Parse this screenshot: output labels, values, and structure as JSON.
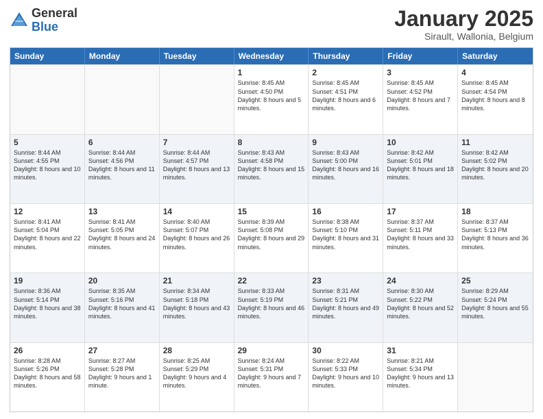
{
  "logo": {
    "general": "General",
    "blue": "Blue"
  },
  "header": {
    "title": "January 2025",
    "location": "Sirault, Wallonia, Belgium"
  },
  "weekdays": [
    "Sunday",
    "Monday",
    "Tuesday",
    "Wednesday",
    "Thursday",
    "Friday",
    "Saturday"
  ],
  "weeks": [
    [
      {
        "day": "",
        "sunrise": "",
        "sunset": "",
        "daylight": ""
      },
      {
        "day": "",
        "sunrise": "",
        "sunset": "",
        "daylight": ""
      },
      {
        "day": "",
        "sunrise": "",
        "sunset": "",
        "daylight": ""
      },
      {
        "day": "1",
        "sunrise": "Sunrise: 8:45 AM",
        "sunset": "Sunset: 4:50 PM",
        "daylight": "Daylight: 8 hours and 5 minutes."
      },
      {
        "day": "2",
        "sunrise": "Sunrise: 8:45 AM",
        "sunset": "Sunset: 4:51 PM",
        "daylight": "Daylight: 8 hours and 6 minutes."
      },
      {
        "day": "3",
        "sunrise": "Sunrise: 8:45 AM",
        "sunset": "Sunset: 4:52 PM",
        "daylight": "Daylight: 8 hours and 7 minutes."
      },
      {
        "day": "4",
        "sunrise": "Sunrise: 8:45 AM",
        "sunset": "Sunset: 4:54 PM",
        "daylight": "Daylight: 8 hours and 8 minutes."
      }
    ],
    [
      {
        "day": "5",
        "sunrise": "Sunrise: 8:44 AM",
        "sunset": "Sunset: 4:55 PM",
        "daylight": "Daylight: 8 hours and 10 minutes."
      },
      {
        "day": "6",
        "sunrise": "Sunrise: 8:44 AM",
        "sunset": "Sunset: 4:56 PM",
        "daylight": "Daylight: 8 hours and 11 minutes."
      },
      {
        "day": "7",
        "sunrise": "Sunrise: 8:44 AM",
        "sunset": "Sunset: 4:57 PM",
        "daylight": "Daylight: 8 hours and 13 minutes."
      },
      {
        "day": "8",
        "sunrise": "Sunrise: 8:43 AM",
        "sunset": "Sunset: 4:58 PM",
        "daylight": "Daylight: 8 hours and 15 minutes."
      },
      {
        "day": "9",
        "sunrise": "Sunrise: 8:43 AM",
        "sunset": "Sunset: 5:00 PM",
        "daylight": "Daylight: 8 hours and 16 minutes."
      },
      {
        "day": "10",
        "sunrise": "Sunrise: 8:42 AM",
        "sunset": "Sunset: 5:01 PM",
        "daylight": "Daylight: 8 hours and 18 minutes."
      },
      {
        "day": "11",
        "sunrise": "Sunrise: 8:42 AM",
        "sunset": "Sunset: 5:02 PM",
        "daylight": "Daylight: 8 hours and 20 minutes."
      }
    ],
    [
      {
        "day": "12",
        "sunrise": "Sunrise: 8:41 AM",
        "sunset": "Sunset: 5:04 PM",
        "daylight": "Daylight: 8 hours and 22 minutes."
      },
      {
        "day": "13",
        "sunrise": "Sunrise: 8:41 AM",
        "sunset": "Sunset: 5:05 PM",
        "daylight": "Daylight: 8 hours and 24 minutes."
      },
      {
        "day": "14",
        "sunrise": "Sunrise: 8:40 AM",
        "sunset": "Sunset: 5:07 PM",
        "daylight": "Daylight: 8 hours and 26 minutes."
      },
      {
        "day": "15",
        "sunrise": "Sunrise: 8:39 AM",
        "sunset": "Sunset: 5:08 PM",
        "daylight": "Daylight: 8 hours and 29 minutes."
      },
      {
        "day": "16",
        "sunrise": "Sunrise: 8:38 AM",
        "sunset": "Sunset: 5:10 PM",
        "daylight": "Daylight: 8 hours and 31 minutes."
      },
      {
        "day": "17",
        "sunrise": "Sunrise: 8:37 AM",
        "sunset": "Sunset: 5:11 PM",
        "daylight": "Daylight: 8 hours and 33 minutes."
      },
      {
        "day": "18",
        "sunrise": "Sunrise: 8:37 AM",
        "sunset": "Sunset: 5:13 PM",
        "daylight": "Daylight: 8 hours and 36 minutes."
      }
    ],
    [
      {
        "day": "19",
        "sunrise": "Sunrise: 8:36 AM",
        "sunset": "Sunset: 5:14 PM",
        "daylight": "Daylight: 8 hours and 38 minutes."
      },
      {
        "day": "20",
        "sunrise": "Sunrise: 8:35 AM",
        "sunset": "Sunset: 5:16 PM",
        "daylight": "Daylight: 8 hours and 41 minutes."
      },
      {
        "day": "21",
        "sunrise": "Sunrise: 8:34 AM",
        "sunset": "Sunset: 5:18 PM",
        "daylight": "Daylight: 8 hours and 43 minutes."
      },
      {
        "day": "22",
        "sunrise": "Sunrise: 8:33 AM",
        "sunset": "Sunset: 5:19 PM",
        "daylight": "Daylight: 8 hours and 46 minutes."
      },
      {
        "day": "23",
        "sunrise": "Sunrise: 8:31 AM",
        "sunset": "Sunset: 5:21 PM",
        "daylight": "Daylight: 8 hours and 49 minutes."
      },
      {
        "day": "24",
        "sunrise": "Sunrise: 8:30 AM",
        "sunset": "Sunset: 5:22 PM",
        "daylight": "Daylight: 8 hours and 52 minutes."
      },
      {
        "day": "25",
        "sunrise": "Sunrise: 8:29 AM",
        "sunset": "Sunset: 5:24 PM",
        "daylight": "Daylight: 8 hours and 55 minutes."
      }
    ],
    [
      {
        "day": "26",
        "sunrise": "Sunrise: 8:28 AM",
        "sunset": "Sunset: 5:26 PM",
        "daylight": "Daylight: 8 hours and 58 minutes."
      },
      {
        "day": "27",
        "sunrise": "Sunrise: 8:27 AM",
        "sunset": "Sunset: 5:28 PM",
        "daylight": "Daylight: 9 hours and 1 minute."
      },
      {
        "day": "28",
        "sunrise": "Sunrise: 8:25 AM",
        "sunset": "Sunset: 5:29 PM",
        "daylight": "Daylight: 9 hours and 4 minutes."
      },
      {
        "day": "29",
        "sunrise": "Sunrise: 8:24 AM",
        "sunset": "Sunset: 5:31 PM",
        "daylight": "Daylight: 9 hours and 7 minutes."
      },
      {
        "day": "30",
        "sunrise": "Sunrise: 8:22 AM",
        "sunset": "Sunset: 5:33 PM",
        "daylight": "Daylight: 9 hours and 10 minutes."
      },
      {
        "day": "31",
        "sunrise": "Sunrise: 8:21 AM",
        "sunset": "Sunset: 5:34 PM",
        "daylight": "Daylight: 9 hours and 13 minutes."
      },
      {
        "day": "",
        "sunrise": "",
        "sunset": "",
        "daylight": ""
      }
    ]
  ]
}
